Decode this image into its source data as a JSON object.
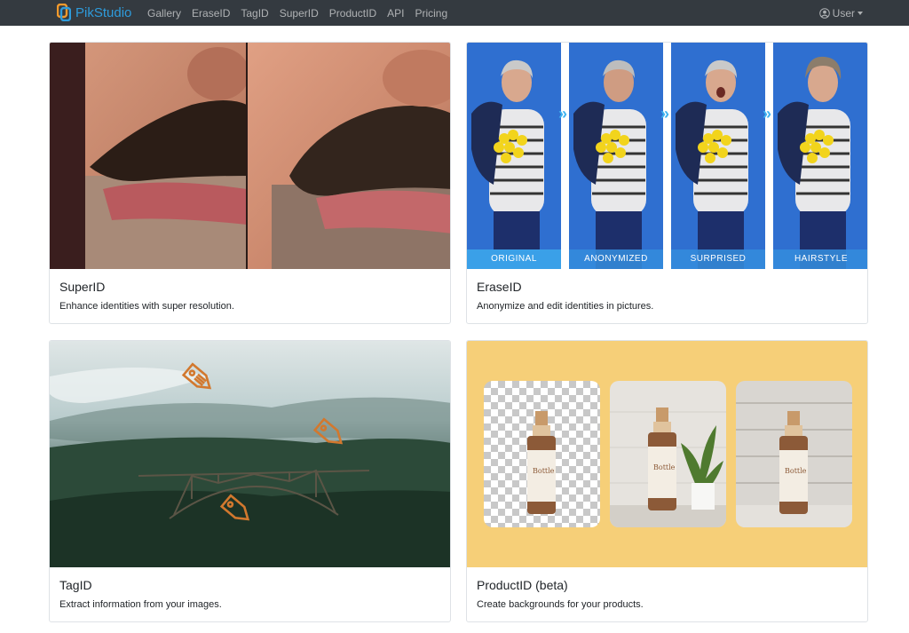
{
  "navbar": {
    "brand": "PikStudio",
    "links": [
      "Gallery",
      "EraseID",
      "TagID",
      "SuperID",
      "ProductID",
      "API",
      "Pricing"
    ],
    "user_label": "User"
  },
  "cards": [
    {
      "title": "SuperID",
      "text": "Enhance identities with super resolution."
    },
    {
      "title": "EraseID",
      "text": "Anonymize and edit identities in pictures.",
      "labels": [
        "ORIGINAL",
        "ANONYMIZED",
        "SURPRISED",
        "HAIRSTYLE"
      ]
    },
    {
      "title": "TagID",
      "text": "Extract information from your images."
    },
    {
      "title": "ProductID (beta)",
      "text": "Create backgrounds for your products.",
      "bottle_label": "Bottle"
    }
  ],
  "colors": {
    "navbar_bg": "#343a40",
    "brand": "#2e9bdb",
    "erase_bg": "#2f6fd0",
    "product_bg": "#f6cf78",
    "tag_orange": "#d2782e"
  },
  "icons": {
    "logo": "pikstudio-logo-icon",
    "user": "user-circle-icon",
    "dropdown": "caret-down-icon",
    "tag": "tag-icon"
  }
}
